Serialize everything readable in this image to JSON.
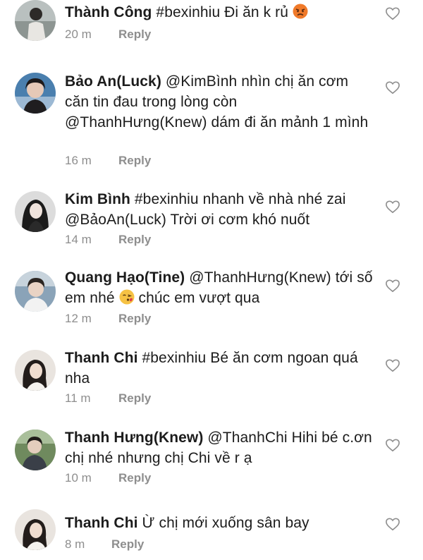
{
  "comments": [
    {
      "author": "Thành Công",
      "text": " #bexinhiu Đi ăn k rủ",
      "emoji": "angry-face-emoji",
      "time": "20 m",
      "reply": "Reply"
    },
    {
      "author": "Bảo An(Luck)",
      "text": " @KimBình nhìn chị ăn cơm căn tin đau trong lòng còn @ThanhHưng(Knew) dám đi ăn mảnh 1 mình",
      "time": "16 m",
      "reply": "Reply"
    },
    {
      "author": "Kim Bình",
      "text": " #bexinhiu nhanh về nhà nhé zai @BảoAn(Luck) Trời ơi cơm khó nuốt",
      "time": "14 m",
      "reply": "Reply"
    },
    {
      "author": "Quang Hạo(Tine)",
      "text_before": " @ThanhHưng(Knew) tới số em nhé ",
      "emoji": "kissing-face-emoji",
      "text_after": " chúc em vượt qua",
      "time": "12 m",
      "reply": "Reply"
    },
    {
      "author": "Thanh Chi",
      "text": " #bexinhiu Bé ăn cơm ngoan quá nha",
      "time": "11 m",
      "reply": "Reply"
    },
    {
      "author": "Thanh Hưng(Knew)",
      "text": " @ThanhChi Hihi bé c.ơn chị nhé nhưng chị Chi về r ạ",
      "time": "10 m",
      "reply": "Reply"
    },
    {
      "author": "Thanh Chi",
      "text": " Ừ chị mới xuống sân bay",
      "time": "8 m",
      "reply": "Reply"
    }
  ],
  "icons": {
    "like": "heart-outline-icon"
  },
  "colors": {
    "text": "#1c1c1c",
    "meta": "#8e8e8e",
    "heart": "#8e8e8e"
  }
}
